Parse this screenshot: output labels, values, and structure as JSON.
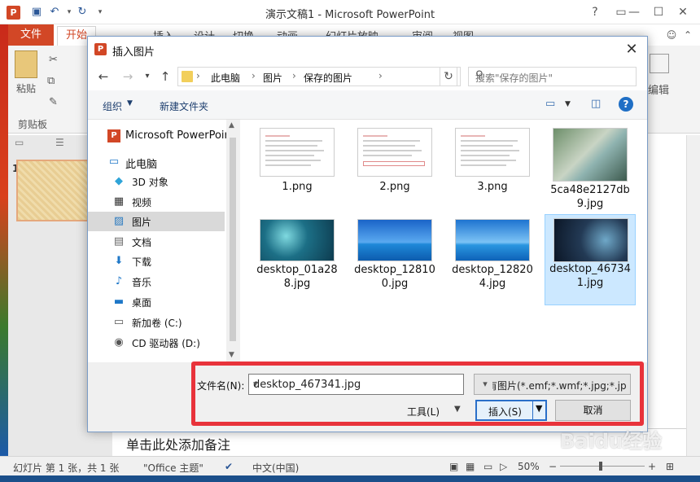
{
  "app": {
    "title": "演示文稿1 - Microsoft PowerPoint",
    "file_tab": "文件",
    "home_tab": "开始",
    "tabs": [
      "插入",
      "设计",
      "切换",
      "动画",
      "幻灯片放映",
      "审阅",
      "视图"
    ],
    "ribbon": {
      "paste": "粘贴",
      "clipboard": "剪贴板",
      "edit": "编辑"
    },
    "notes_placeholder": "单击此处添加备注",
    "slide_number": "1",
    "status": {
      "slide_info": "幻灯片 第 1 张，共 1 张",
      "theme": "\"Office 主题\"",
      "language": "中文(中国)",
      "zoom": "50%"
    }
  },
  "dialog": {
    "title": "插入图片",
    "breadcrumb": [
      "此电脑",
      "图片",
      "保存的图片"
    ],
    "search_placeholder": "搜索\"保存的图片\"",
    "toolbar": {
      "organize": "组织",
      "new_folder": "新建文件夹"
    },
    "nav_items": [
      {
        "label": "Microsoft PowerPoir",
        "icon": "powerpoint-icon"
      },
      {
        "label": "此电脑",
        "icon": "computer-icon"
      },
      {
        "label": "3D 对象",
        "icon": "3d-objects-icon"
      },
      {
        "label": "视频",
        "icon": "video-icon"
      },
      {
        "label": "图片",
        "icon": "pictures-icon",
        "selected": true
      },
      {
        "label": "文档",
        "icon": "documents-icon"
      },
      {
        "label": "下载",
        "icon": "download-icon"
      },
      {
        "label": "音乐",
        "icon": "music-icon"
      },
      {
        "label": "桌面",
        "icon": "desktop-icon"
      },
      {
        "label": "新加卷 (C:)",
        "icon": "drive-icon"
      },
      {
        "label": "CD 驱动器 (D:)",
        "icon": "cd-drive-icon"
      }
    ],
    "files": [
      {
        "name": "1.png",
        "kind": "doc"
      },
      {
        "name": "2.png",
        "kind": "doc"
      },
      {
        "name": "3.png",
        "kind": "doc"
      },
      {
        "name": "5ca48e2127db9.jpg",
        "kind": "art"
      },
      {
        "name": "desktop_01a288.jpg",
        "kind": "teal"
      },
      {
        "name": "desktop_128100.jpg",
        "kind": "sea"
      },
      {
        "name": "desktop_128204.jpg",
        "kind": "sea"
      },
      {
        "name": "desktop_467341.jpg",
        "kind": "dark",
        "selected": true
      }
    ],
    "filename_label": "文件名(N):",
    "filename_value": "desktop_467341.jpg",
    "filetype_value": "所有图片(*.emf;*.wmf;*.jpg;*.jp",
    "tools_label": "工具(L)",
    "insert_label": "插入(S)",
    "cancel_label": "取消"
  },
  "watermark": "Baidu经验",
  "colors": {
    "accent": "#d24726",
    "highlight": "#e8333b",
    "selection": "#cce8ff"
  }
}
